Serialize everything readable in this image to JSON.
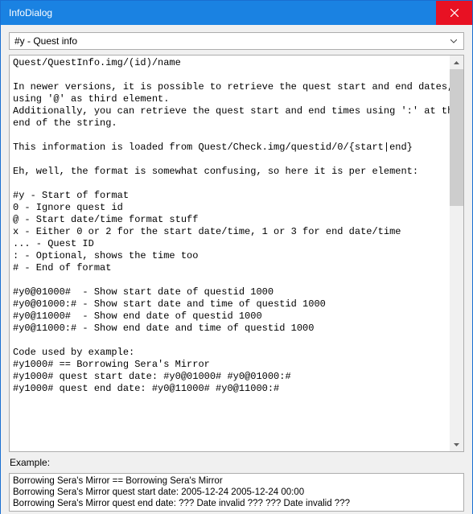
{
  "window": {
    "title": "InfoDialog"
  },
  "dropdown": {
    "selected": "#y - Quest info"
  },
  "main_text": "Quest/QuestInfo.img/(id)/name\n\nIn newer versions, it is possible to retrieve the quest start and end dates,\nusing '@' as third element.\nAdditionally, you can retrieve the quest start and end times using ':' at the\nend of the string.\n\nThis information is loaded from Quest/Check.img/questid/0/{start|end}\n\nEh, well, the format is somewhat confusing, so here it is per element:\n\n#y - Start of format\n0 - Ignore quest id\n@ - Start date/time format stuff\nx - Either 0 or 2 for the start date/time, 1 or 3 for end date/time\n... - Quest ID\n: - Optional, shows the time too\n# - End of format\n\n#y0@01000#  - Show start date of questid 1000\n#y0@01000:# - Show start date and time of questid 1000\n#y0@11000#  - Show end date of questid 1000\n#y0@11000:# - Show end date and time of questid 1000\n\nCode used by example:\n#y1000# == Borrowing Sera's Mirror\n#y1000# quest start date: #y0@01000# #y0@01000:#\n#y1000# quest end date: #y0@11000# #y0@11000:#",
  "example_label": "Example:",
  "example_text": "Borrowing Sera's Mirror == Borrowing Sera's Mirror\nBorrowing Sera's Mirror quest start date: 2005-12-24 2005-12-24 00:00\nBorrowing Sera's Mirror quest end date: ??? Date invalid ??? ??? Date invalid ???",
  "colors": {
    "accent": "#1a82e2",
    "close": "#e81123"
  }
}
